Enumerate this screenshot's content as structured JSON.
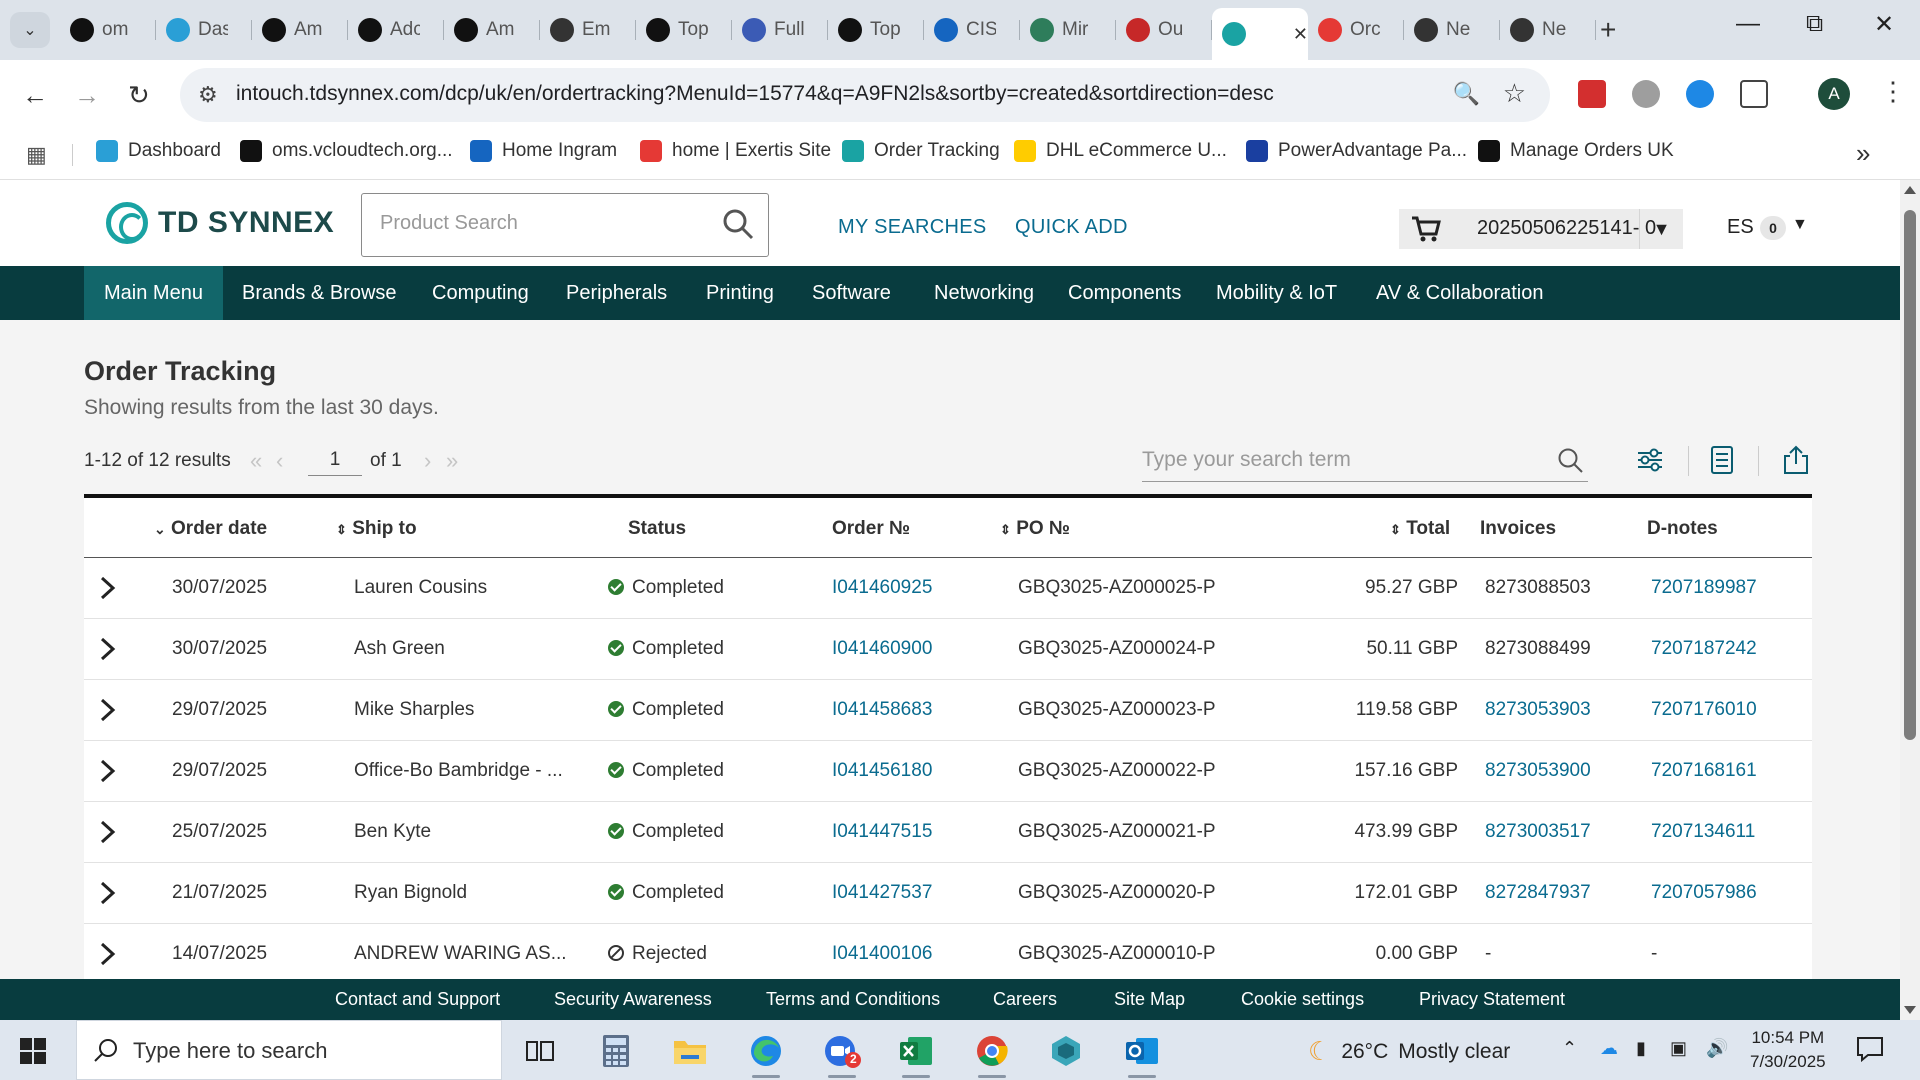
{
  "browser": {
    "tabs": [
      {
        "title": "om",
        "favicon": "vcloud-icon",
        "color": "#111111"
      },
      {
        "title": "Das",
        "favicon": "dashboard-icon",
        "color": "#2a9fd6"
      },
      {
        "title": "Am",
        "favicon": "amazon-icon",
        "color": "#111111"
      },
      {
        "title": "Adc",
        "favicon": "amazon-icon",
        "color": "#111111"
      },
      {
        "title": "Am",
        "favicon": "amazon-icon",
        "color": "#111111"
      },
      {
        "title": "Em",
        "favicon": "openai-icon",
        "color": "#333333"
      },
      {
        "title": "Top",
        "favicon": "c-icon",
        "color": "#111111"
      },
      {
        "title": "Full",
        "favicon": "box-icon",
        "color": "#3b5bb5"
      },
      {
        "title": "Top",
        "favicon": "c-icon",
        "color": "#111111"
      },
      {
        "title": "CIS",
        "favicon": "ingram-icon",
        "color": "#1565c0"
      },
      {
        "title": "Mir",
        "favicon": "mirakl-icon",
        "color": "#2e7d5b"
      },
      {
        "title": "Ou",
        "favicon": "shein-icon",
        "color": "#c62828"
      },
      {
        "title": "",
        "favicon": "tdsynnex-icon",
        "color": "#1aa3a3",
        "active": true
      },
      {
        "title": "Orc",
        "favicon": "exertis-icon",
        "color": "#e53935"
      },
      {
        "title": "Ne",
        "favicon": "openai-icon",
        "color": "#333333"
      },
      {
        "title": "Ne",
        "favicon": "openai-icon",
        "color": "#333333"
      }
    ],
    "url": "intouch.tdsynnex.com/dcp/uk/en/ordertracking?MenuId=15774&q=A9FN2ls&sortby=created&sortdirection=desc",
    "avatar_letter": "A",
    "bookmarks": [
      {
        "label": "Dashboard",
        "favicon": "dashboard-icon",
        "color": "#2a9fd6"
      },
      {
        "label": "oms.vcloudtech.org...",
        "favicon": "vcloud-icon",
        "color": "#111111"
      },
      {
        "label": "Home Ingram",
        "favicon": "ingram-icon",
        "color": "#1565c0"
      },
      {
        "label": "home | Exertis Site",
        "favicon": "exertis-icon",
        "color": "#e53935"
      },
      {
        "label": "Order Tracking",
        "favicon": "tdsynnex-icon",
        "color": "#1aa3a3"
      },
      {
        "label": "DHL eCommerce U...",
        "favicon": "dhl-icon",
        "color": "#ffcc00"
      },
      {
        "label": "PowerAdvantage Pa...",
        "favicon": "poweradvantage-icon",
        "color": "#1a3fa0"
      },
      {
        "label": "Manage Orders UK",
        "favicon": "amazon-icon",
        "color": "#111111"
      }
    ]
  },
  "site": {
    "logo_text": "TD SYNNEX",
    "search_placeholder": "Product Search",
    "my_searches": "MY SEARCHES",
    "quick_add": "QUICK ADD",
    "cart_id": "20250506225141- 0",
    "user_initials": "ES",
    "user_count": "0",
    "nav": [
      "Main Menu",
      "Brands & Browse",
      "Computing",
      "Peripherals",
      "Printing",
      "Software",
      "Networking",
      "Components",
      "Mobility & IoT",
      "AV & Collaboration"
    ]
  },
  "page": {
    "title": "Order Tracking",
    "subtitle": "Showing results from the last 30 days.",
    "results_text": "1-12 of 12 results",
    "page_value": "1",
    "page_of": "of 1",
    "search_placeholder": "Type your search term"
  },
  "table": {
    "headers": {
      "order_date": "Order date",
      "ship_to": "Ship to",
      "status": "Status",
      "order_no": "Order №",
      "po_no": "PO №",
      "total": "Total",
      "invoices": "Invoices",
      "dnotes": "D-notes"
    },
    "rows": [
      {
        "date": "30/07/2025",
        "ship_to": "Lauren Cousins",
        "status": "Completed",
        "status_type": "completed",
        "order_no": "I041460925",
        "po_no": "GBQ3025-AZ000025-P",
        "total": "95.27 GBP",
        "invoice": "8273088503",
        "invoice_link": false,
        "dnote": "7207189987",
        "dnote_link": true
      },
      {
        "date": "30/07/2025",
        "ship_to": "Ash Green",
        "status": "Completed",
        "status_type": "completed",
        "order_no": "I041460900",
        "po_no": "GBQ3025-AZ000024-P",
        "total": "50.11 GBP",
        "invoice": "8273088499",
        "invoice_link": false,
        "dnote": "7207187242",
        "dnote_link": true
      },
      {
        "date": "29/07/2025",
        "ship_to": "Mike Sharples",
        "status": "Completed",
        "status_type": "completed",
        "order_no": "I041458683",
        "po_no": "GBQ3025-AZ000023-P",
        "total": "119.58 GBP",
        "invoice": "8273053903",
        "invoice_link": true,
        "dnote": "7207176010",
        "dnote_link": true
      },
      {
        "date": "29/07/2025",
        "ship_to": "Office-Bo Bambridge - ...",
        "status": "Completed",
        "status_type": "completed",
        "order_no": "I041456180",
        "po_no": "GBQ3025-AZ000022-P",
        "total": "157.16 GBP",
        "invoice": "8273053900",
        "invoice_link": true,
        "dnote": "7207168161",
        "dnote_link": true
      },
      {
        "date": "25/07/2025",
        "ship_to": "Ben Kyte",
        "status": "Completed",
        "status_type": "completed",
        "order_no": "I041447515",
        "po_no": "GBQ3025-AZ000021-P",
        "total": "473.99 GBP",
        "invoice": "8273003517",
        "invoice_link": true,
        "dnote": "7207134611",
        "dnote_link": true
      },
      {
        "date": "21/07/2025",
        "ship_to": "Ryan Bignold",
        "status": "Completed",
        "status_type": "completed",
        "order_no": "I041427537",
        "po_no": "GBQ3025-AZ000020-P",
        "total": "172.01 GBP",
        "invoice": "8272847937",
        "invoice_link": true,
        "dnote": "7207057986",
        "dnote_link": true
      },
      {
        "date": "14/07/2025",
        "ship_to": "ANDREW WARING AS...",
        "status": "Rejected",
        "status_type": "rejected",
        "order_no": "I041400106",
        "po_no": "GBQ3025-AZ000010-P",
        "total": "0.00 GBP",
        "invoice": "-",
        "invoice_link": false,
        "dnote": "-",
        "dnote_link": false
      }
    ]
  },
  "footer": [
    "Contact and Support",
    "Security Awareness",
    "Terms and Conditions",
    "Careers",
    "Site Map",
    "Cookie settings",
    "Privacy Statement"
  ],
  "taskbar": {
    "search_placeholder": "Type here to search",
    "zoom_badge": "2",
    "weather_temp": "26°C",
    "weather_desc": "Mostly clear",
    "time": "10:54 PM",
    "date": "7/30/2025"
  },
  "colors": {
    "nav_bg": "#083c3f",
    "nav_active": "#12666a",
    "link": "#0a6b8f",
    "status_completed": "#2e7d32"
  }
}
